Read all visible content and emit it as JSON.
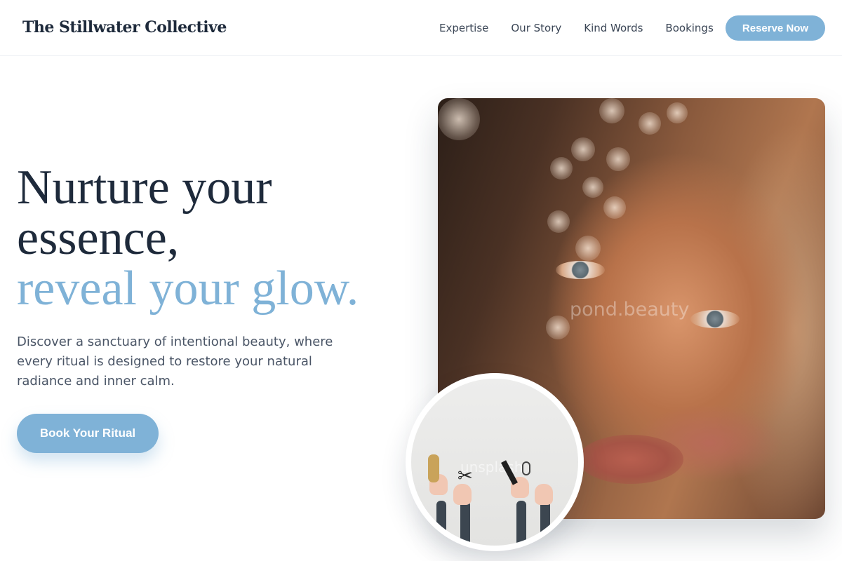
{
  "header": {
    "brand": "The Stillwater Collective",
    "nav": [
      "Expertise",
      "Our Story",
      "Kind Words",
      "Bookings"
    ],
    "cta": "Reserve Now"
  },
  "hero": {
    "headline_line1": "Nurture your",
    "headline_line2": "essence,",
    "headline_accent": "reveal your glow.",
    "description": "Discover a sanctuary of intentional beauty, where every ritual is designed to restore your natural radiance and inner calm.",
    "cta": "Book Your Ritual"
  },
  "images": {
    "portrait_watermark": "pond.beauty",
    "circle_watermark": "unsplash"
  },
  "colors": {
    "accent": "#7fb2d7",
    "text_dark": "#1e2a3b",
    "text_body": "#4a5566"
  }
}
